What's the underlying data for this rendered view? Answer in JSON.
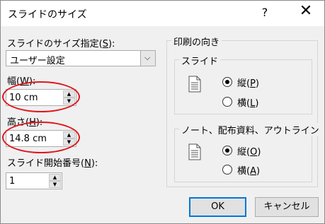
{
  "title": "スライドのサイズ",
  "help_label": "?",
  "close_label": "✕",
  "size_spec": {
    "label_pre": "スライドのサイズ指定(",
    "accel": "S",
    "label_post": "):",
    "value": "ユーザー設定"
  },
  "width": {
    "label_pre": "幅(",
    "accel": "W",
    "label_post": "):",
    "value": "10 cm"
  },
  "height": {
    "label_pre": "高さ(",
    "accel": "H",
    "label_post": "):",
    "value": "14.8 cm"
  },
  "start_number": {
    "label_pre": "スライド開始番号(",
    "accel": "N",
    "label_post": "):",
    "value": "1"
  },
  "orientation": {
    "title": "印刷の向き",
    "slides": {
      "title": "スライド",
      "portrait": {
        "pre": "縦(",
        "accel": "P",
        "post": ")",
        "selected": true
      },
      "landscape": {
        "pre": "横(",
        "accel": "L",
        "post": ")",
        "selected": false
      }
    },
    "notes": {
      "title": "ノート、配布資料、アウトライン",
      "portrait": {
        "pre": "縦(",
        "accel": "O",
        "post": ")",
        "selected": true
      },
      "landscape": {
        "pre": "横(",
        "accel": "A",
        "post": ")",
        "selected": false
      }
    }
  },
  "buttons": {
    "ok": "OK",
    "cancel": "キャンセル"
  },
  "colors": {
    "highlight_ring": "#e0161d",
    "default_button_border": "#0078d7"
  }
}
